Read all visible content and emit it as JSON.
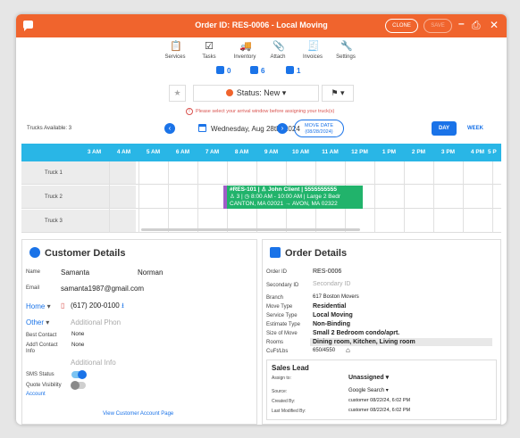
{
  "window": {
    "title": "Order ID: RES-0006 - Local Moving",
    "clone_label": "CLONE",
    "save_label": "SAVE"
  },
  "toolbar": [
    {
      "label": "Services",
      "icon": "clipboard-icon",
      "glyph": "📋"
    },
    {
      "label": "Tasks",
      "icon": "checkbox-icon",
      "glyph": "☑"
    },
    {
      "label": "Inventory",
      "icon": "truck-icon",
      "glyph": "🚚"
    },
    {
      "label": "Attach",
      "icon": "paperclip-icon",
      "glyph": "📎"
    },
    {
      "label": "Invoices",
      "icon": "invoice-icon",
      "glyph": "🧾"
    },
    {
      "label": "Settings",
      "icon": "wrench-icon",
      "glyph": "🔧"
    }
  ],
  "counts": {
    "chart": "0",
    "calendar": "6",
    "messages": "1"
  },
  "status": {
    "label": "Status: New",
    "accent": "#f0642d"
  },
  "warning": "Please select your arrival window before assigning your truck(s)",
  "schedule": {
    "trucks_available": "Trucks Available: 3",
    "date": "Wednesday, Aug 28th, 2024",
    "move_date_label": "MOVE DATE",
    "move_date_value": "(08/28/2024)",
    "day_label": "DAY",
    "week_label": "WEEK",
    "hours": [
      "3 AM",
      "4 AM",
      "5 AM",
      "6 AM",
      "7 AM",
      "8 AM",
      "9 AM",
      "10 AM",
      "11 AM",
      "12 PM",
      "1 PM",
      "2 PM",
      "3 PM",
      "4 PM",
      "5 P"
    ],
    "trucks": [
      "Truck 1",
      "Truck 2",
      "Truck 3"
    ],
    "job": {
      "line1": "#RES-101 | ♙ John Client | 5555555555",
      "line2": "♙ 3 | ◷ 8:00 AM - 10:00 AM | Large 2 Bedr",
      "line3": "CANTON, MA 02021 → AVON, MA 02322",
      "color": "#21b36b"
    }
  },
  "customer": {
    "heading": "Customer Details",
    "name_label": "Name",
    "first_name": "Samanta",
    "last_name": "Norman",
    "email_label": "Email",
    "email": "samanta1987@gmail.com",
    "phone_type": "Home",
    "phone": "(617) 200-0100",
    "other_label": "Other",
    "additional_phone": "Additional Phon",
    "best_contact_label": "Best Contact",
    "best_contact": "None",
    "add_contact_label": "Add'l Contact Info",
    "add_contact": "None",
    "additional_info": "Additional Info",
    "sms_label": "SMS Status",
    "quote_label": "Quote Visibility",
    "account_label": "Account",
    "view_link": "View Customer Account Page"
  },
  "order": {
    "heading": "Order Details",
    "rows": [
      {
        "label": "Order ID",
        "value": "RES-0006",
        "style": "normal"
      },
      {
        "label": "Secondary ID",
        "value": "Secondary ID",
        "style": "placeholder"
      },
      {
        "label": "Branch",
        "value": "617 Boston Movers",
        "style": "small"
      },
      {
        "label": "Move Type",
        "value": "Residential",
        "style": "bold"
      },
      {
        "label": "Service Type",
        "value": "Local Moving",
        "style": "bold"
      },
      {
        "label": "Estimate Type",
        "value": "Non-Binding",
        "style": "bold"
      },
      {
        "label": "Size of Move",
        "value": "Small 2 Bedroom condo/aprt.",
        "style": "bold"
      },
      {
        "label": "Rooms",
        "value": "Dining room, Kitchen, Living room",
        "style": "shaded"
      },
      {
        "label": "CuFt/Lbs",
        "value": "650/4550",
        "style": "small"
      }
    ],
    "sales_lead": {
      "heading": "Sales Lead",
      "assign_label": "Assign to:",
      "assign_value": "Unassigned",
      "source_label": "Source:",
      "source_value": "Google Search",
      "created_label": "Created By:",
      "created_value": "customer 08/22/24, 6:02 PM",
      "modified_label": "Last Modified By:",
      "modified_value": "customer 08/22/24, 6:02 PM"
    }
  },
  "colors": {
    "brand": "#f0642d",
    "accent": "#1a73e8",
    "timeline": "#29b6e6"
  }
}
